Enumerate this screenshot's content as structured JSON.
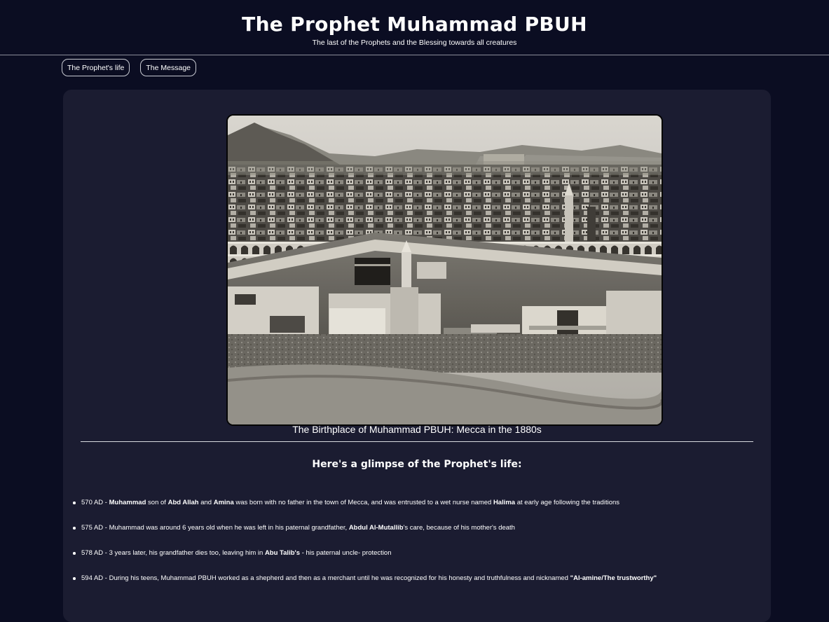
{
  "header": {
    "title": "The Prophet Muhammad PBUH",
    "tagline": "The last of the Prophets and the Blessing towards all creatures"
  },
  "nav": {
    "items": [
      {
        "label": "The Prophet's life"
      },
      {
        "label": "The Message"
      }
    ]
  },
  "hero": {
    "caption": "The Birthplace of Muhammad PBUH: Mecca in the 1880s"
  },
  "timeline": {
    "heading": "Here's a glimpse of the Prophet's life:",
    "items": [
      {
        "year": "570 AD -",
        "name": "Muhammad",
        "text_1": "son of",
        "father": "Abd Allah",
        "text_2": "and",
        "mother": "Amina",
        "text_3": "was born with no father in the town of Mecca, and was entrusted to a wet nurse named",
        "nurse": "Halima",
        "text_4": "at early age following the traditions"
      },
      {
        "year": "575 AD -",
        "text_1": "Muhammad was around 6 years old when he was left in his paternal grandfather,",
        "grandfather": "Abdul Al-Mutallib",
        "text_2": "'s care, because of his mother's death"
      },
      {
        "year": "578 AD -",
        "text_1": "3 years later, his grandfather dies too, leaving him in",
        "uncle": "Abu Talib's",
        "text_2": "- his paternal uncle- protection"
      },
      {
        "year": "594 AD -",
        "text_1": "During his teens, Muhammad PBUH worked as a shepherd and then as a merchant until he was recognized for his honesty and truthfulness and nicknamed",
        "nickname": "\"Al-amine/The trustworthy\""
      }
    ]
  },
  "colors": {
    "page_background": "#0b0d22",
    "card_background": "#1b1c31",
    "text": "#ffffff",
    "divider": "#d9dbe0"
  }
}
